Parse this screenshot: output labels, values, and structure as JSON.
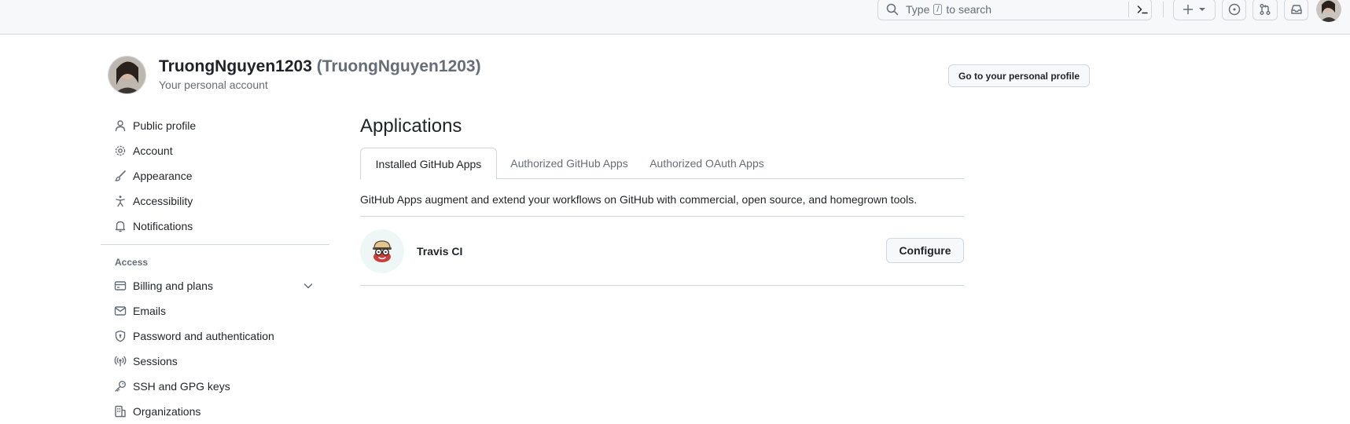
{
  "header": {
    "search_prefix": "Type",
    "search_key": "/",
    "search_suffix": "to search",
    "icons": [
      "search-icon",
      "command-palette-icon",
      "plus-icon",
      "triangle-down-icon",
      "issue-opened-icon",
      "pull-request-icon",
      "inbox-icon"
    ]
  },
  "profile": {
    "name": "TruongNguyen1203",
    "login": "(TruongNguyen1203)",
    "subtitle": "Your personal account",
    "profile_button": "Go to your personal profile"
  },
  "sidebar": {
    "items_top": [
      {
        "label": "Public profile",
        "icon": "person-icon"
      },
      {
        "label": "Account",
        "icon": "gear-icon"
      },
      {
        "label": "Appearance",
        "icon": "paintbrush-icon"
      },
      {
        "label": "Accessibility",
        "icon": "accessibility-icon"
      },
      {
        "label": "Notifications",
        "icon": "bell-icon"
      }
    ],
    "access_heading": "Access",
    "items_access": [
      {
        "label": "Billing and plans",
        "icon": "credit-card-icon"
      },
      {
        "label": "Emails",
        "icon": "mail-icon"
      },
      {
        "label": "Password and authentication",
        "icon": "shield-lock-icon"
      },
      {
        "label": "Sessions",
        "icon": "broadcast-icon"
      },
      {
        "label": "SSH and GPG keys",
        "icon": "key-icon"
      },
      {
        "label": "Organizations",
        "icon": "organization-icon"
      }
    ]
  },
  "main": {
    "title": "Applications",
    "tabs": [
      {
        "label": "Installed GitHub Apps",
        "selected": true
      },
      {
        "label": "Authorized GitHub Apps",
        "selected": false
      },
      {
        "label": "Authorized OAuth Apps",
        "selected": false
      }
    ],
    "description": "GitHub Apps augment and extend your workflows on GitHub with commercial, open source, and homegrown tools.",
    "apps": [
      {
        "name": "Travis CI",
        "action": "Configure"
      }
    ]
  },
  "colors": {
    "text": "#1f2328",
    "muted": "#656d76",
    "border": "#d0d7de",
    "header_bg": "#f6f8fa"
  }
}
